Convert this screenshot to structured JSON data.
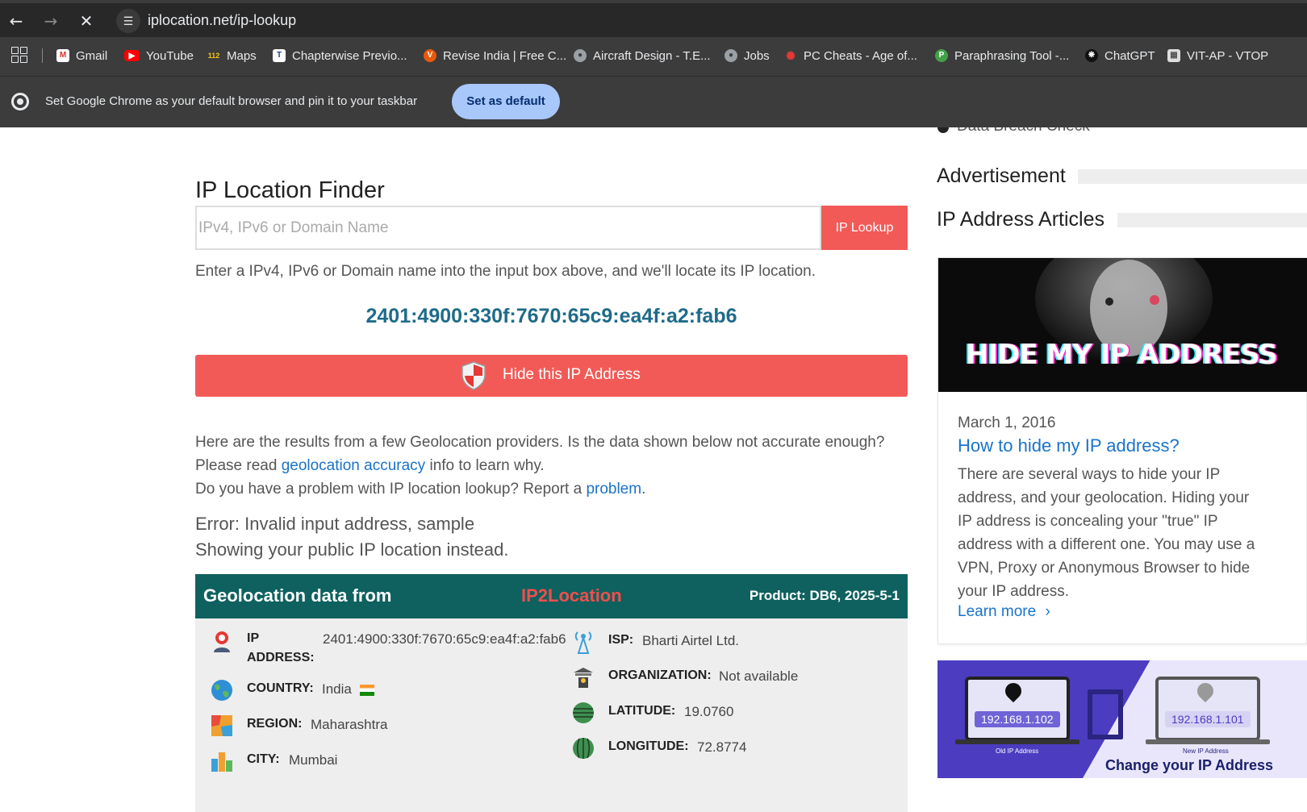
{
  "browser": {
    "url": "iplocation.net/ip-lookup",
    "bookmarks": [
      {
        "label": "Gmail",
        "icon": "gmail-icon"
      },
      {
        "label": "YouTube",
        "icon": "youtube-icon"
      },
      {
        "label": "Maps",
        "icon": "maps-icon"
      },
      {
        "label": "Chapterwise Previo...",
        "icon": "chapterwise-icon"
      },
      {
        "label": "Revise India | Free C...",
        "icon": "revise-india-icon"
      },
      {
        "label": "Aircraft Design - T.E...",
        "icon": "globe-icon"
      },
      {
        "label": "Jobs",
        "icon": "globe-icon"
      },
      {
        "label": "PC Cheats - Age of...",
        "icon": "pc-cheats-icon"
      },
      {
        "label": "Paraphrasing Tool -...",
        "icon": "paraphrasing-icon"
      },
      {
        "label": "ChatGPT",
        "icon": "chatgpt-icon"
      },
      {
        "label": "VIT-AP - VTOP",
        "icon": "vtop-icon"
      }
    ],
    "infobar": {
      "text": "Set Google Chrome as your default browser and pin it to your taskbar",
      "button": "Set as default"
    }
  },
  "main": {
    "partial_sidebar_item": "Data Breach Check",
    "title": "IP Location Finder",
    "search_placeholder": "IPv4, IPv6 or Domain Name",
    "lookup_button": "IP Lookup",
    "hint": "Enter a IPv4, IPv6 or Domain name into the input box above, and we'll locate its IP location.",
    "ip": "2401:4900:330f:7670:65c9:ea4f:a2:fab6",
    "hide_button": "Hide this IP Address",
    "para1": "Here are the results from a few Geolocation providers. Is the data shown below not accurate enough?",
    "para2_pre": "Please read ",
    "para2_link": "geolocation accuracy",
    "para2_post": " info to learn why.",
    "para3_pre": "Do you have a problem with IP location lookup? Report a ",
    "para3_link": "problem",
    "para3_post": ".",
    "error1": "Error: Invalid input address, sample",
    "error2": "Showing your public IP location instead.",
    "geo": {
      "heading": "Geolocation data from",
      "provider": "IP2Location",
      "product": "Product: DB6, 2025-5-1",
      "ip_label_1": "IP",
      "ip_label_2": "ADDRESS:",
      "ip_value": "2401:4900:330f:7670:65c9:ea4f:a2:fab6",
      "country_label": "COUNTRY:",
      "country_value": "India",
      "region_label": "REGION:",
      "region_value": "Maharashtra",
      "city_label": "CITY:",
      "city_value": "Mumbai",
      "isp_label": "ISP:",
      "isp_value": "Bharti Airtel Ltd.",
      "org_label": "ORGANIZATION:",
      "org_value": "Not available",
      "lat_label": "LATITUDE:",
      "lat_value": "19.0760",
      "lon_label": "LONGITUDE:",
      "lon_value": "72.8774"
    }
  },
  "sidebar": {
    "advert": "Advertisement",
    "articles": "IP Address Articles",
    "card": {
      "image_text": "HIDE MY IP ADDRESS",
      "date": "March 1, 2016",
      "title": "How to hide my IP address?",
      "desc": "There are several ways to hide your IP address, and your geolocation. Hiding your IP address is concealing your \"true\" IP address with a different one. You may use a VPN, Proxy or Anonymous Browser to hide your IP address.",
      "more": "Learn more"
    },
    "card2": {
      "old_ip": "192.168.1.102",
      "new_ip": "192.168.1.101",
      "old_caption": "Old IP Address",
      "new_caption": "New IP Address",
      "banner": "Change your IP Address"
    }
  }
}
